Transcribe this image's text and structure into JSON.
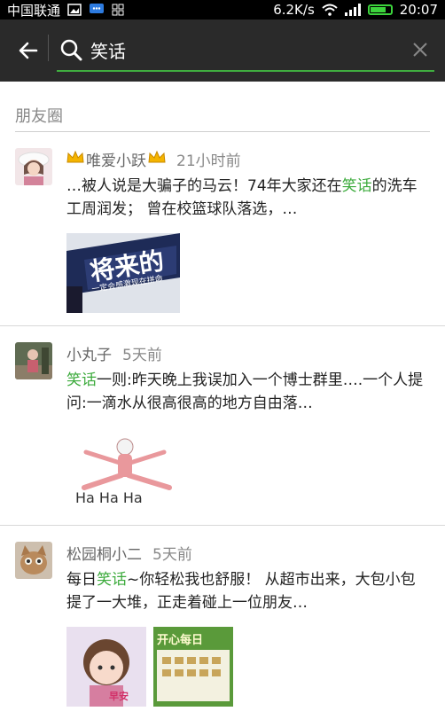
{
  "status_bar": {
    "carrier": "中国联通",
    "net_speed": "6.2K/s",
    "time": "20:07",
    "battery_level": 0.7
  },
  "search": {
    "query": "笑话",
    "back_icon": "arrow-left-icon",
    "search_icon": "magnifier-icon",
    "clear_icon": "close-icon"
  },
  "section": {
    "title": "朋友圈"
  },
  "posts": [
    {
      "name": "唯爱小跃",
      "time": "21小时前",
      "text_before": "…被人说是大骗子的马云！74年大家还在",
      "highlight": "笑话",
      "text_after": "的洗车工周润发； 曾在校篮球队落选，…",
      "image_caption": "将来的",
      "image_sub": "一定会感激现在拼命"
    },
    {
      "name": "小丸子",
      "time": "5天前",
      "text_before": "",
      "highlight": "笑话",
      "text_after": "一则:昨天晚上我误加入一个博士群里….一个人提问:一滴水从很高很高的地方自由落…",
      "image_caption": "Ha Ha Ha"
    },
    {
      "name": "松园桐小二",
      "time": "5天前",
      "text_before": "每日",
      "highlight": "笑话",
      "text_after": "~你轻松我也舒服！ 从超市出来，大包小包提了一大堆，正走着碰上一位朋友…",
      "image1_caption": "早安",
      "image2_caption": "开心每日"
    }
  ],
  "colors": {
    "accent_green": "#3dab3d",
    "header_bg": "#2a2a2a",
    "status_bg": "#000000"
  }
}
